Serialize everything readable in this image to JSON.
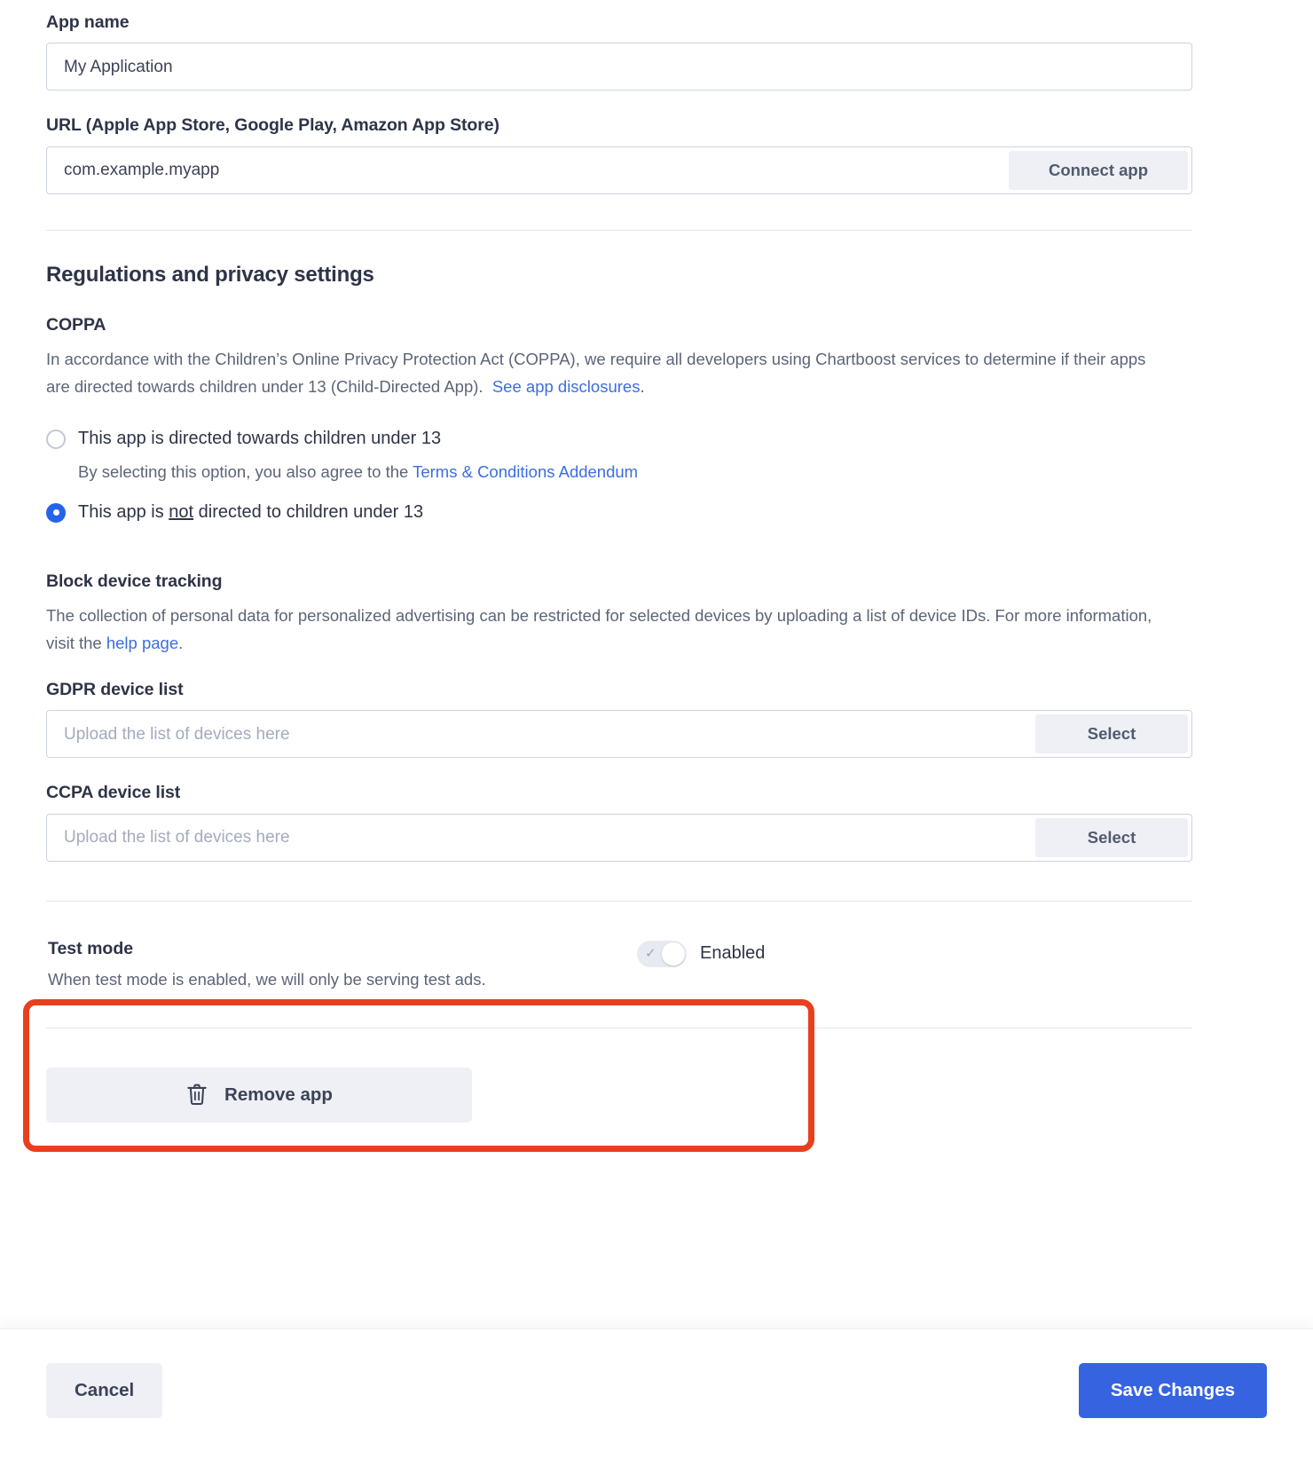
{
  "app_name": {
    "label": "App name",
    "value": "My Application"
  },
  "url_field": {
    "label": "URL (Apple App Store, Google Play, Amazon App Store)",
    "value": "com.example.myapp",
    "button_label": "Connect app"
  },
  "regulations": {
    "section_title": "Regulations and privacy settings",
    "coppa": {
      "title": "COPPA",
      "description_part1": "In accordance with the Children’s Online Privacy Protection Act (COPPA), we require all developers using Chartboost services to determine if their apps are directed towards children under 13 (Child-Directed App).",
      "disclosures_link": "See app disclosures",
      "description_end": ".",
      "options": [
        {
          "label": "This app is directed towards children under 13",
          "selected": false,
          "sub_prefix": "By selecting this option, you also agree to the ",
          "sub_link": "Terms & Conditions Addendum"
        },
        {
          "label_before": "This app is ",
          "label_emphasis": "not",
          "label_after": " directed to children under 13",
          "selected": true
        }
      ]
    },
    "block_device_tracking": {
      "title": "Block device tracking",
      "description_part1": "The collection of personal data for personalized advertising can be restricted for selected devices by uploading a list of device IDs. For more information, visit the ",
      "help_link": "help page",
      "description_end": ".",
      "gdpr": {
        "label": "GDPR device list",
        "placeholder": "Upload the list of devices here",
        "button_label": "Select"
      },
      "ccpa": {
        "label": "CCPA device list",
        "placeholder": "Upload the list of devices here",
        "button_label": "Select"
      }
    }
  },
  "test_mode": {
    "title": "Test mode",
    "description": "When test mode is enabled, we will only be serving test ads.",
    "toggle_state_label": "Enabled",
    "toggle_on": true,
    "highlight_color": "#e8401f"
  },
  "remove_app": {
    "label": "Remove app",
    "icon": "trash-icon"
  },
  "footer": {
    "cancel_label": "Cancel",
    "save_label": "Save Changes",
    "save_color": "#3664e0"
  }
}
